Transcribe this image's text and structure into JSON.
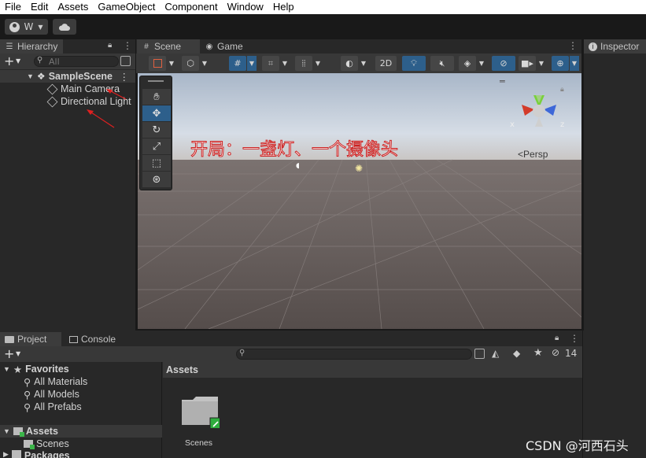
{
  "menubar": {
    "items": [
      "File",
      "Edit",
      "Assets",
      "GameObject",
      "Component",
      "Window",
      "Help"
    ]
  },
  "toolbar": {
    "account_label": "W",
    "account_icon": "account-icon",
    "cloud_icon": "cloud-icon"
  },
  "hierarchy": {
    "tab_label": "Hierarchy",
    "search_placeholder": "All",
    "scene_name": "SampleScene",
    "objects": [
      "Main Camera",
      "Directional Light"
    ]
  },
  "scene_tabs": {
    "scene_label": "Scene",
    "game_label": "Game"
  },
  "scene_toolbar": {
    "mode_2d": "2D"
  },
  "scene_view": {
    "annotation": "开局：一盏灯、一个摄像头",
    "persp_label": "Persp",
    "axis_x": "x",
    "axis_z": "z",
    "sky_color": "#cfd9e6",
    "ground_color": "#5d5452"
  },
  "inspector": {
    "tab_label": "Inspector"
  },
  "project": {
    "project_tab": "Project",
    "console_tab": "Console",
    "favorites_label": "Favorites",
    "favorites": [
      "All Materials",
      "All Models",
      "All Prefabs"
    ],
    "assets_label": "Assets",
    "assets_children": [
      "Scenes"
    ],
    "packages_label": "Packages",
    "breadcrumb": "Assets",
    "folder_label": "Scenes",
    "hidden_count": "14"
  },
  "watermark": "CSDN @河西石头"
}
